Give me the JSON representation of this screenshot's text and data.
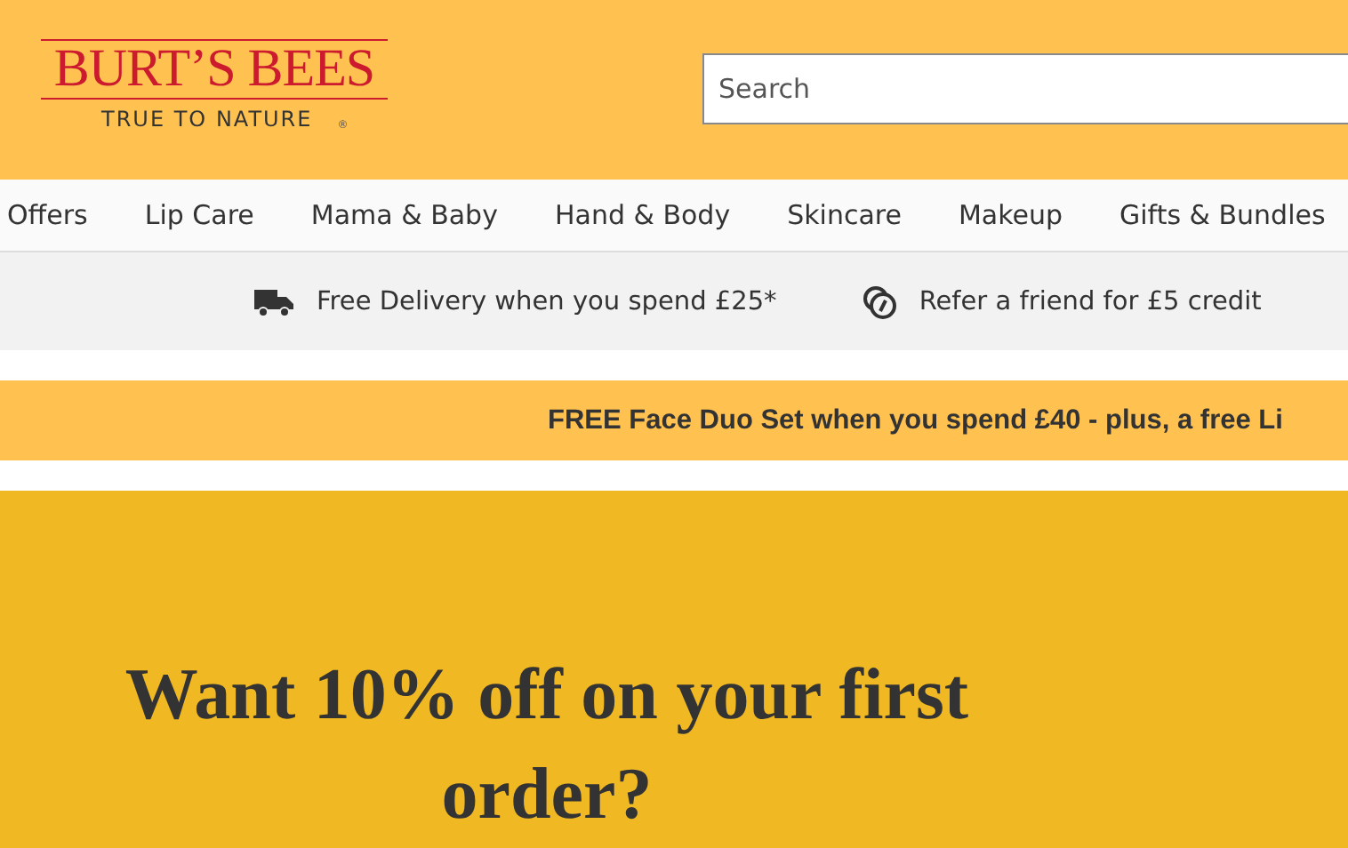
{
  "logo": {
    "name": "BURT’S BEES",
    "tagline": "TRUE TO NATURE",
    "mark": "®"
  },
  "search": {
    "placeholder": "Search"
  },
  "nav": {
    "items": [
      "Offers",
      "Lip Care",
      "Mama & Baby",
      "Hand & Body",
      "Skincare",
      "Makeup",
      "Gifts & Bundles"
    ]
  },
  "usp_bar": [
    {
      "kind": "truck",
      "text": "Free Delivery when you spend £25*"
    },
    {
      "kind": "referral",
      "text": "Refer a friend for £5 credit"
    }
  ],
  "promo_banner": {
    "text": "FREE Face Duo Set when you spend £40 - plus, a free Li"
  },
  "hero": {
    "headline": "Want 10% off on your first order?"
  }
}
